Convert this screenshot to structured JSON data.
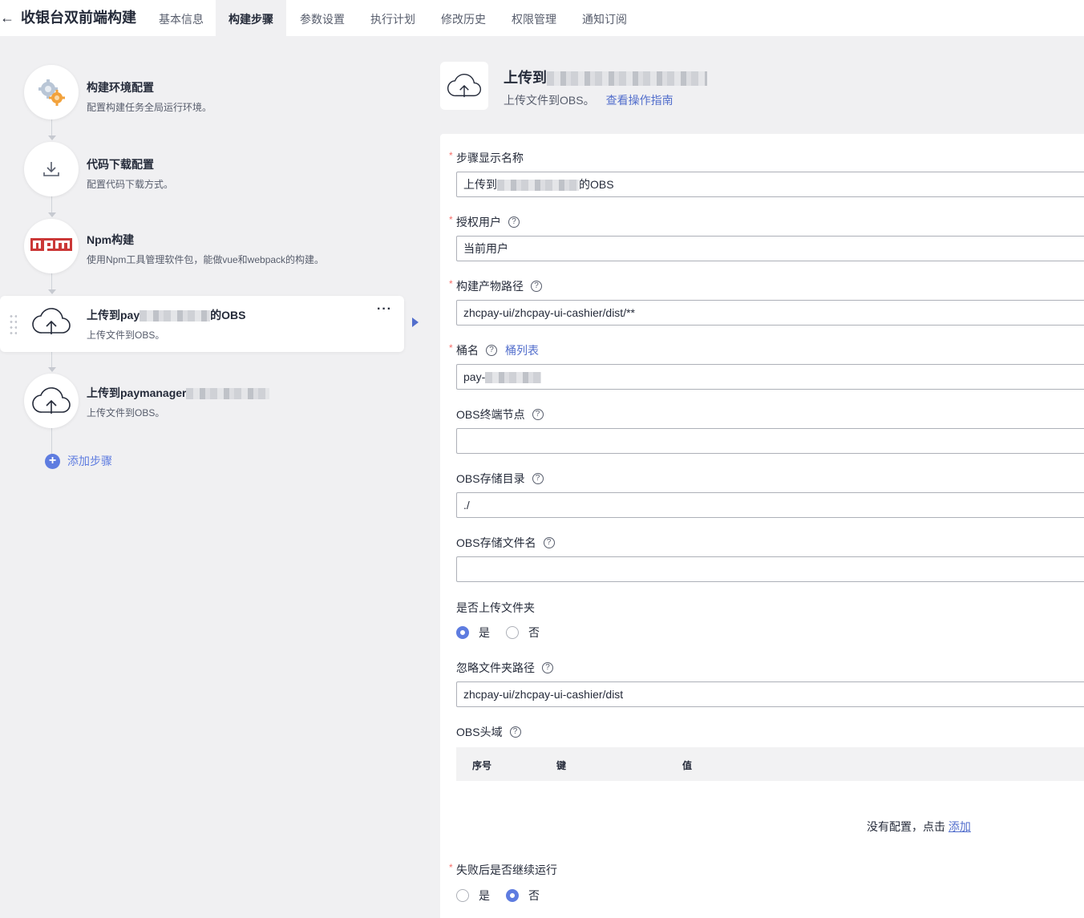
{
  "header": {
    "back_icon": "arrow-left-icon",
    "title": "收银台双前端构建",
    "tabs": [
      "基本信息",
      "构建步骤",
      "参数设置",
      "执行计划",
      "修改历史",
      "权限管理",
      "通知订阅"
    ],
    "active_tab": "构建步骤"
  },
  "steps": [
    {
      "icon": "gears-icon",
      "name": "构建环境配置",
      "desc": "配置构建任务全局运行环境。"
    },
    {
      "icon": "download-icon",
      "name": "代码下载配置",
      "desc": "配置代码下载方式。"
    },
    {
      "icon": "npm-logo-icon",
      "name": "Npm构建",
      "desc": "使用Npm工具管理软件包，能做vue和webpack的构建。"
    },
    {
      "icon": "cloud-upload-icon",
      "name_prefix": "上传到pay",
      "name_suffix": "的OBS",
      "desc": "上传文件到OBS。"
    },
    {
      "icon": "cloud-upload-icon",
      "name_prefix": "上传到paymanager",
      "name_suffix": "",
      "desc": "上传文件到OBS。"
    }
  ],
  "add_step_label": "添加步骤",
  "detail": {
    "title": "上传到",
    "subtitle": "上传文件到OBS。",
    "guide_link": "查看操作指南"
  },
  "form": {
    "display_name": {
      "label": "步骤显示名称",
      "value_prefix": "上传到",
      "value_suffix": "的OBS"
    },
    "auth_user": {
      "label": "授权用户",
      "value": "当前用户"
    },
    "artifact_path": {
      "label": "构建产物路径",
      "value": "zhcpay-ui/zhcpay-ui-cashier/dist/**"
    },
    "bucket": {
      "label": "桶名",
      "link": "桶列表",
      "value_prefix": "pay-"
    },
    "obs_endpoint": {
      "label": "OBS终端节点",
      "value": ""
    },
    "obs_dir": {
      "label": "OBS存储目录",
      "value": "./"
    },
    "obs_filename": {
      "label": "OBS存储文件名",
      "value": ""
    },
    "upload_folder": {
      "label": "是否上传文件夹",
      "options": [
        "是",
        "否"
      ],
      "selected": "是"
    },
    "ignore_path": {
      "label": "忽略文件夹路径",
      "value": "zhcpay-ui/zhcpay-ui-cashier/dist"
    },
    "obs_headers": {
      "label": "OBS头域",
      "columns": [
        "序号",
        "键",
        "值"
      ],
      "empty_text": "没有配置，点击",
      "empty_link": "添加"
    },
    "continue_on_fail": {
      "label": "失败后是否继续运行",
      "options": [
        "是",
        "否"
      ],
      "selected": "否"
    }
  },
  "colors": {
    "accent": "#5e7ce0",
    "link": "#526ecc",
    "required": "#f66f6a",
    "npm_red": "#cb3837"
  }
}
